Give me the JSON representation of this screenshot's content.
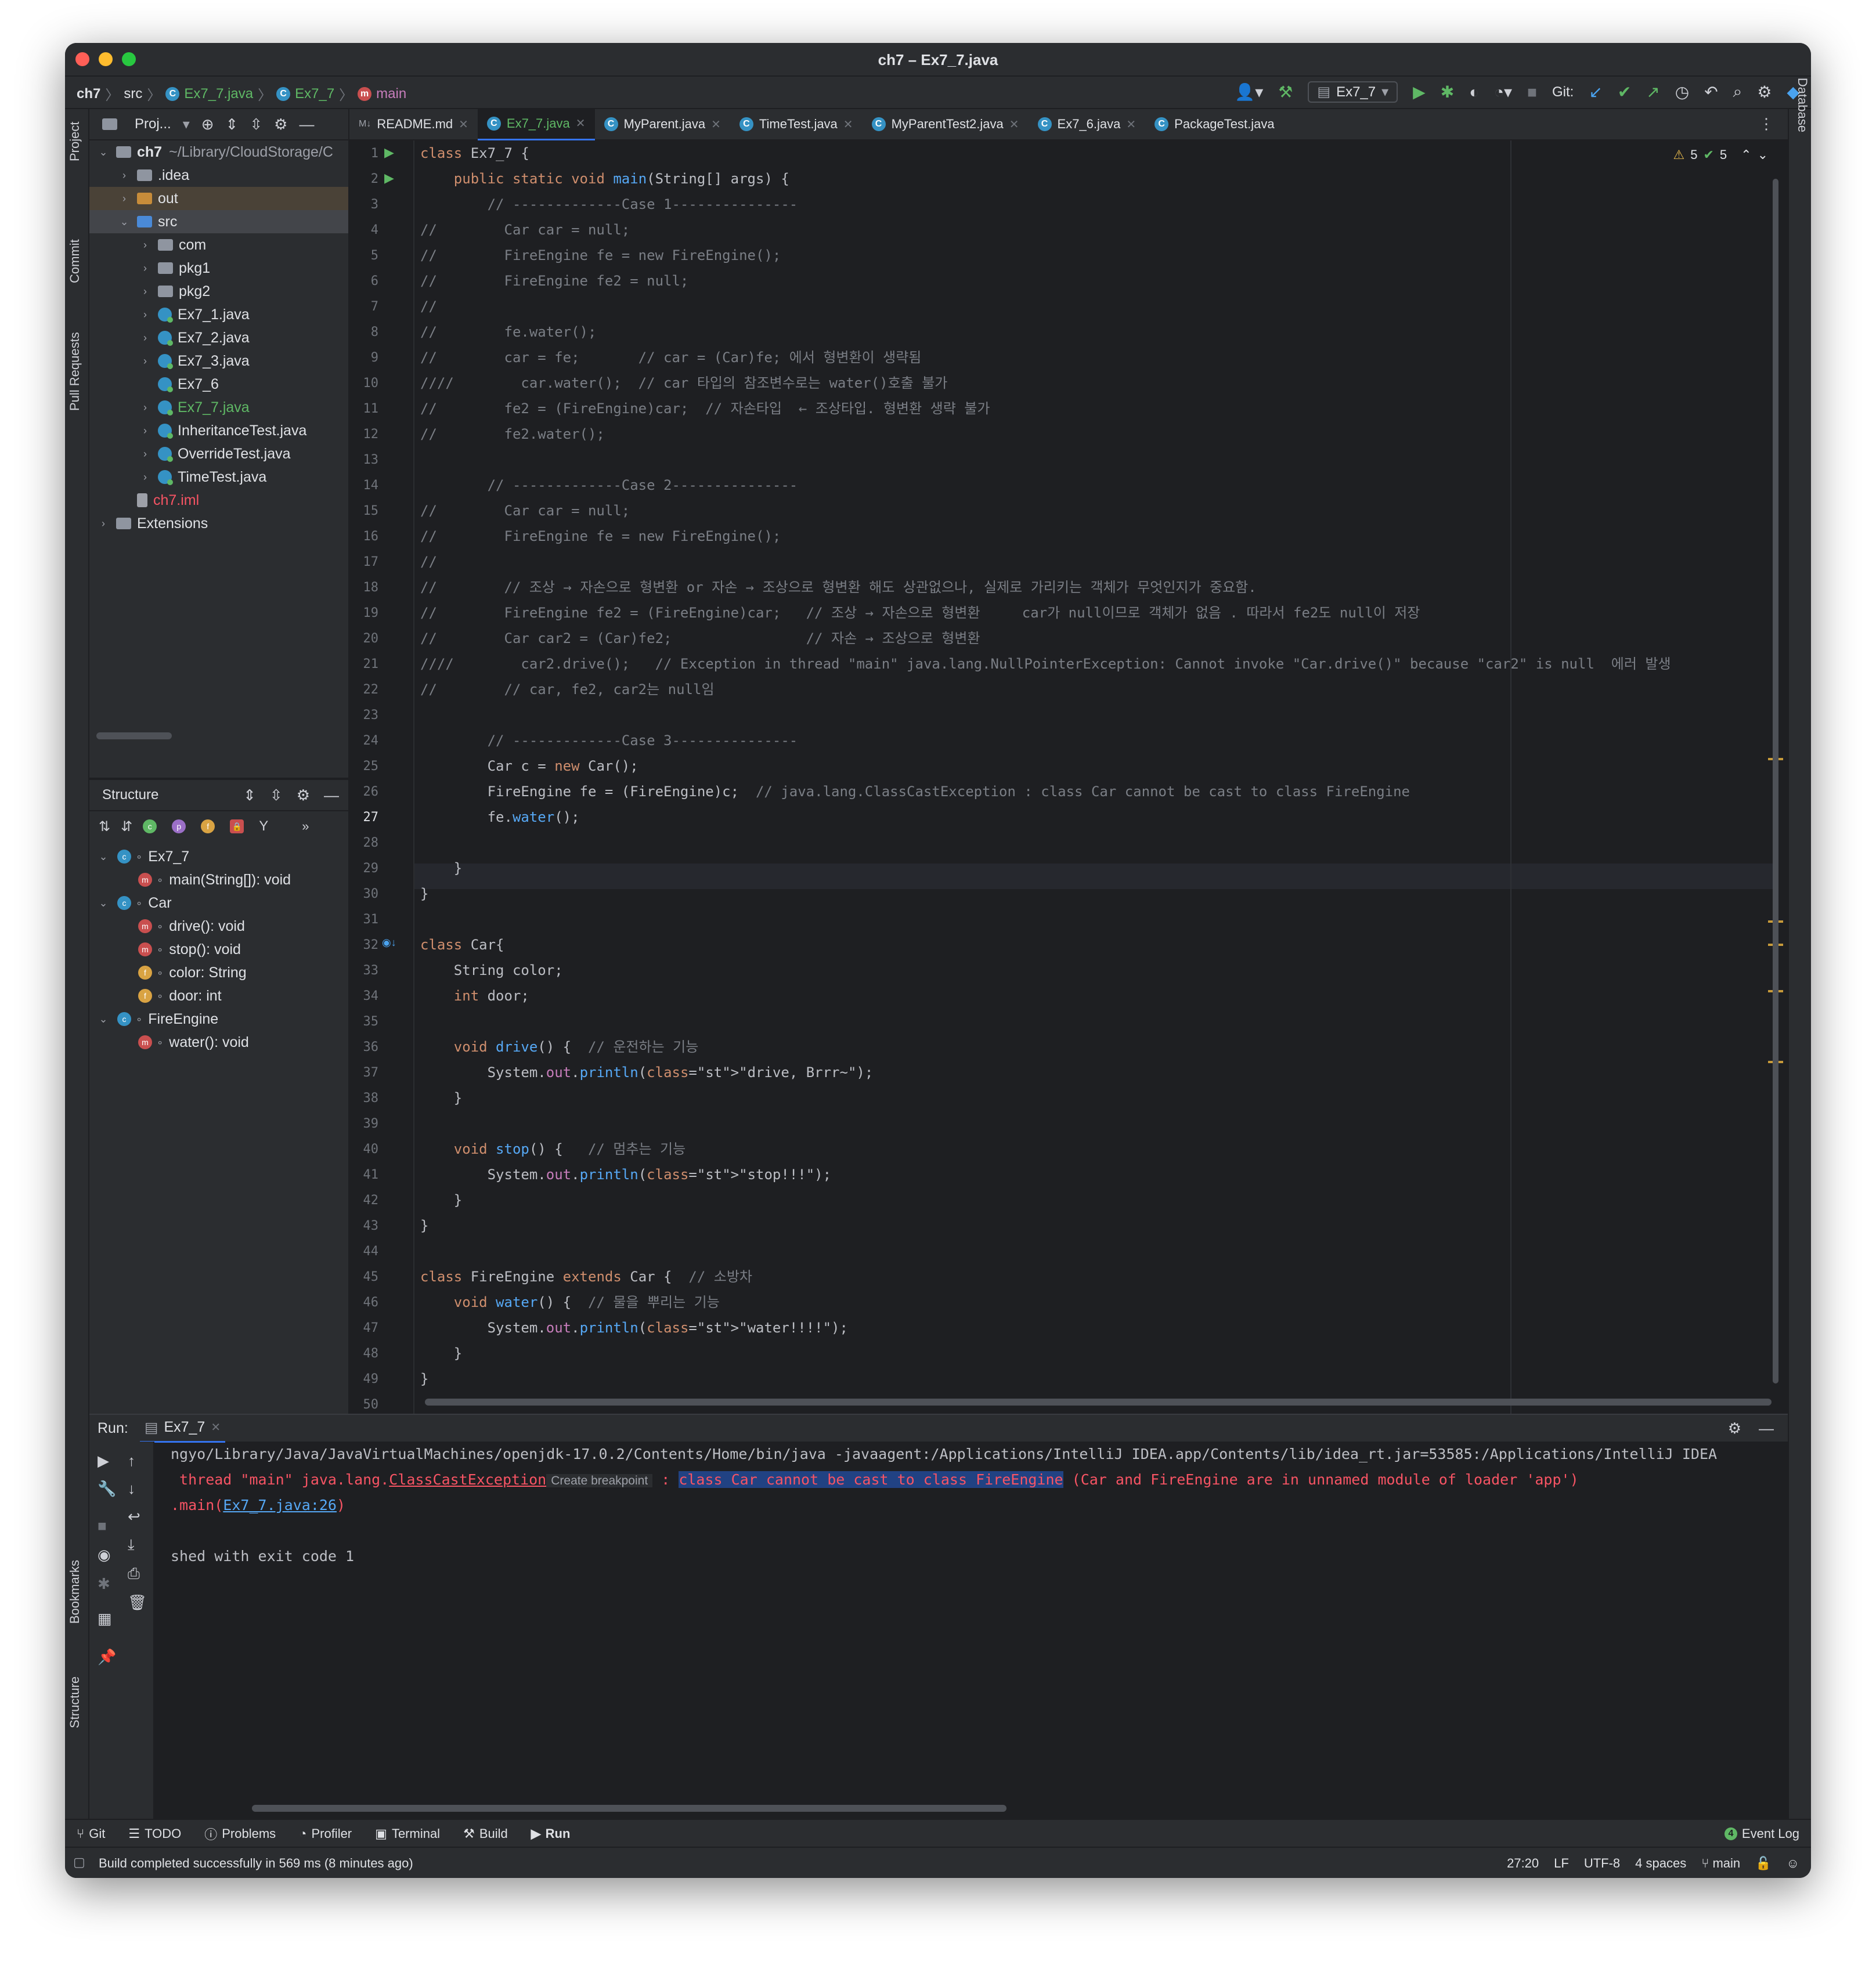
{
  "window": {
    "title": "ch7 – Ex7_7.java"
  },
  "breadcrumb": {
    "items": [
      "ch7",
      "src",
      "Ex7_7.java",
      "Ex7_7",
      "main"
    ]
  },
  "toolbar": {
    "run_config": "Ex7_7",
    "git_label": "Git:"
  },
  "left_stripe": {
    "project": "Project",
    "commit": "Commit",
    "pull_requests": "Pull Requests",
    "bookmarks": "Bookmarks",
    "structure": "Structure"
  },
  "right_stripe": {
    "database": "Database"
  },
  "project_panel": {
    "header": "Proj...",
    "tree": [
      {
        "label": "ch7",
        "extra": "~/Library/CloudStorage/C",
        "indent": 0,
        "type": "folder",
        "expanded": true,
        "bold": true
      },
      {
        "label": ".idea",
        "indent": 1,
        "type": "folder",
        "expanded": false
      },
      {
        "label": "out",
        "indent": 1,
        "type": "folder-orange",
        "expanded": false,
        "highlight": true
      },
      {
        "label": "src",
        "indent": 1,
        "type": "folder-blue",
        "expanded": true,
        "selected": true
      },
      {
        "label": "com",
        "indent": 2,
        "type": "folder",
        "expanded": false
      },
      {
        "label": "pkg1",
        "indent": 2,
        "type": "folder",
        "expanded": false
      },
      {
        "label": "pkg2",
        "indent": 2,
        "type": "folder",
        "expanded": false
      },
      {
        "label": "Ex7_1.java",
        "indent": 2,
        "type": "class",
        "expanded": false
      },
      {
        "label": "Ex7_2.java",
        "indent": 2,
        "type": "class",
        "expanded": false
      },
      {
        "label": "Ex7_3.java",
        "indent": 2,
        "type": "class",
        "expanded": false
      },
      {
        "label": "Ex7_6",
        "indent": 2,
        "type": "class",
        "noarrow": true
      },
      {
        "label": "Ex7_7.java",
        "indent": 2,
        "type": "class",
        "expanded": false,
        "color": "#5fb865"
      },
      {
        "label": "InheritanceTest.java",
        "indent": 2,
        "type": "class",
        "expanded": false
      },
      {
        "label": "OverrideTest.java",
        "indent": 2,
        "type": "class",
        "expanded": false
      },
      {
        "label": "TimeTest.java",
        "indent": 2,
        "type": "class",
        "expanded": false
      },
      {
        "label": "ch7.iml",
        "indent": 1,
        "type": "file",
        "noarrow": true,
        "color": "#f75464"
      },
      {
        "label": "Extensions",
        "indent": 0,
        "type": "folder",
        "expanded": false
      }
    ]
  },
  "structure_panel": {
    "header": "Structure",
    "items": [
      {
        "label": "Ex7_7",
        "indent": 0,
        "kind": "class",
        "chev": true
      },
      {
        "label": "main(String[]): void",
        "indent": 1,
        "kind": "method"
      },
      {
        "label": "Car",
        "indent": 0,
        "kind": "class",
        "chev": true
      },
      {
        "label": "drive(): void",
        "indent": 1,
        "kind": "method"
      },
      {
        "label": "stop(): void",
        "indent": 1,
        "kind": "method"
      },
      {
        "label": "color: String",
        "indent": 1,
        "kind": "field"
      },
      {
        "label": "door: int",
        "indent": 1,
        "kind": "field"
      },
      {
        "label": "FireEngine",
        "indent": 0,
        "kind": "class",
        "chev": true
      },
      {
        "label": "water(): void",
        "indent": 1,
        "kind": "method"
      }
    ]
  },
  "editor": {
    "tabs": [
      "README.md",
      "Ex7_7.java",
      "MyParent.java",
      "TimeTest.java",
      "MyParentTest2.java",
      "Ex7_6.java",
      "PackageTest.java"
    ],
    "active_tab": 1,
    "inspections": {
      "warnings": "5",
      "checks": "5"
    },
    "current_line": 27,
    "lines": [
      "class Ex7_7 {",
      "    public static void main(String[] args) {",
      "        // -------------Case 1---------------",
      "//        Car car = null;",
      "//        FireEngine fe = new FireEngine();",
      "//        FireEngine fe2 = null;",
      "//",
      "//        fe.water();",
      "//        car = fe;       // car = (Car)fe; 에서 형변환이 생략됨",
      "////        car.water();  // car 타입의 참조변수로는 water()호출 불가",
      "//        fe2 = (FireEngine)car;  // 자손타입  ← 조상타입. 형변환 생략 불가",
      "//        fe2.water();",
      "",
      "        // -------------Case 2---------------",
      "//        Car car = null;",
      "//        FireEngine fe = new FireEngine();",
      "//",
      "//        // 조상 → 자손으로 형변환 or 자손 → 조상으로 형변환 해도 상관없으나, 실제로 가리키는 객체가 무엇인지가 중요함.",
      "//        FireEngine fe2 = (FireEngine)car;   // 조상 → 자손으로 형변환     car가 null이므로 객체가 없음 . 따라서 fe2도 null이 저장",
      "//        Car car2 = (Car)fe2;                // 자손 → 조상으로 형변환",
      "////        car2.drive();   // Exception in thread \"main\" java.lang.NullPointerException: Cannot invoke \"Car.drive()\" because \"car2\" is null  에러 발생",
      "//        // car, fe2, car2는 null임",
      "",
      "        // -------------Case 3---------------",
      "        Car c = new Car();",
      "        FireEngine fe = (FireEngine)c;  // java.lang.ClassCastException : class Car cannot be cast to class FireEngine",
      "        fe.water();",
      "",
      "    }",
      "}",
      "",
      "class Car{",
      "    String color;",
      "    int door;",
      "",
      "    void drive() {  // 운전하는 기능",
      "        System.out.println(\"drive, Brrr~\");",
      "    }",
      "",
      "    void stop() {   // 멈추는 기능",
      "        System.out.println(\"stop!!!\");",
      "    }",
      "}",
      "",
      "class FireEngine extends Car {  // 소방차",
      "    void water() {  // 물을 뿌리는 기능",
      "        System.out.println(\"water!!!!\");",
      "    }",
      "}",
      ""
    ]
  },
  "run_panel": {
    "label": "Run:",
    "tab": "Ex7_7",
    "console": {
      "line1": "ngyo/Library/Java/JavaVirtualMachines/openjdk-17.0.2/Contents/Home/bin/java -javaagent:/Applications/IntelliJ IDEA.app/Contents/lib/idea_rt.jar=53585:/Applications/IntelliJ IDEA",
      "line2_prefix": " thread \"main\" java.lang.",
      "line2_exception": "ClassCastException",
      "line2_breakpoint": "Create breakpoint",
      "line2_colon": " : ",
      "line2_message": "class Car cannot be cast to class FireEngine",
      "line2_suffix": " (Car and FireEngine are in unnamed module of loader 'app')",
      "line3_prefix": ".main(",
      "line3_link": "Ex7_7.java:26",
      "line3_suffix": ")",
      "line4": "shed with exit code 1"
    }
  },
  "bottom_tabs": [
    "Git",
    "TODO",
    "Problems",
    "Profiler",
    "Terminal",
    "Build",
    "Run"
  ],
  "event_log": {
    "count": "4",
    "label": "Event Log"
  },
  "status_bar": {
    "message": "Build completed successfully in 569 ms (8 minutes ago)",
    "position": "27:20",
    "line_sep": "LF",
    "encoding": "UTF-8",
    "indent": "4 spaces",
    "branch": "main"
  },
  "colors": {
    "accent": "#3574f0",
    "green": "#5fb865",
    "error": "#f75464",
    "keyword": "#cf8e6d",
    "comment": "#7a7e85"
  }
}
